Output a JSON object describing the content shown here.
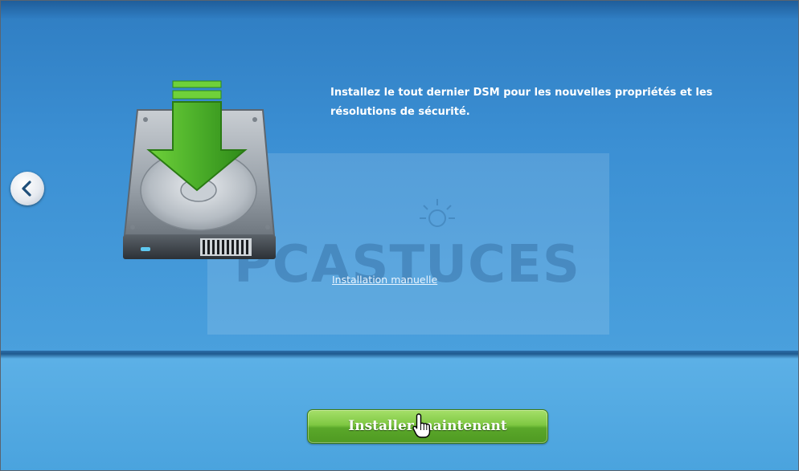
{
  "description": {
    "line1": "Installez le tout dernier DSM pour les nouvelles propriétés et les",
    "line2": "résolutions de sécurité."
  },
  "links": {
    "manual_install": "Installation manuelle"
  },
  "buttons": {
    "install_now": "Installer maintenant",
    "back_icon": "chevron-left-icon"
  },
  "watermark": {
    "text": "PCASTUCES"
  },
  "icons": {
    "hdd": "hard-drive-download-icon",
    "cursor": "hand-pointer-icon"
  },
  "colors": {
    "panel_blue": "#3b8fd3",
    "install_green": "#7fc843",
    "arrow_green": "#4caf2a"
  }
}
